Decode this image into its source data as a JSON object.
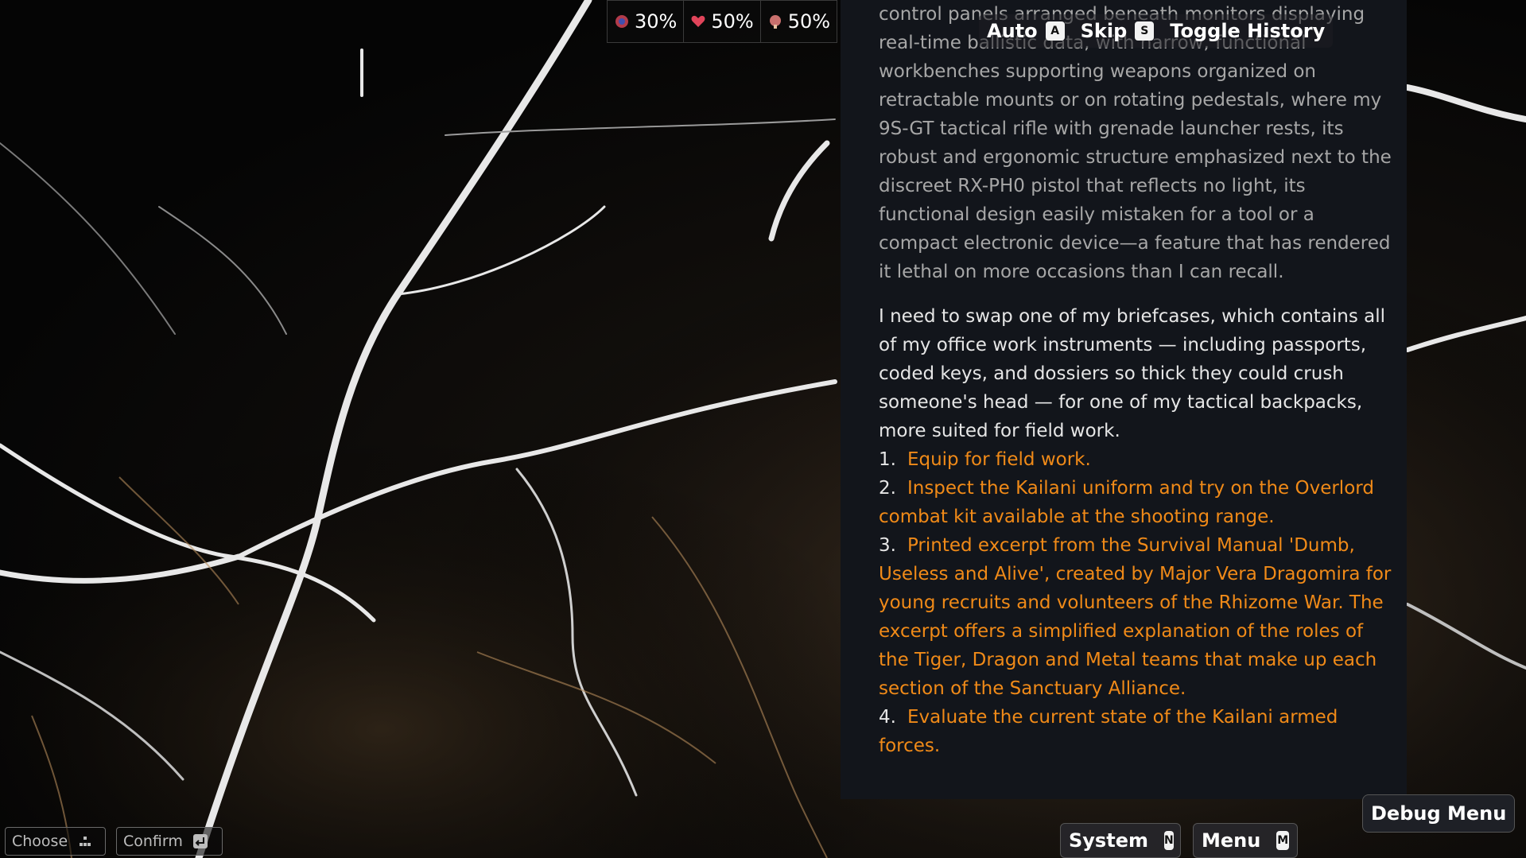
{
  "stats": [
    {
      "icon": "sanity-icon",
      "value": "30%",
      "color": "#b23b4a"
    },
    {
      "icon": "heart-icon",
      "value": "50%",
      "color": "#e0445a"
    },
    {
      "icon": "brain-icon",
      "value": "50%",
      "color": "#c9706d"
    }
  ],
  "controls": {
    "auto_label": "Auto",
    "auto_key": "A",
    "skip_label": "Skip",
    "skip_key": "S",
    "history_label": "Toggle History"
  },
  "narrative": {
    "faded_paragraph": "control panels arranged beneath monitors displaying real-time ballistic data, with narrow, functional workbenches supporting weapons organized on retractable mounts or on rotating pedestals, where my 9S-GT tactical rifle with grenade launcher rests, its robust and ergonomic structure emphasized next to the discreet RX-PH0 pistol that reflects no light, its functional design easily mistaken for a tool or a compact electronic device—a feature that has rendered it lethal on more occasions than I can recall.",
    "main_paragraph": "I need to swap one of my briefcases, which contains all of my office work instruments — including passports, coded keys, and dossiers so thick they could crush someone's head — for one of my tactical backpacks, more suited for field work."
  },
  "options": [
    {
      "num": "1.",
      "text": "Equip for field work."
    },
    {
      "num": "2.",
      "text": "Inspect the Kailani uniform and try on the Overlord combat kit available at the shooting range."
    },
    {
      "num": "3.",
      "text": "Printed excerpt from the Survival Manual 'Dumb, Useless and Alive', created by Major Vera Dragomira for young recruits and volunteers of the Rhizome War. The excerpt offers a simplified explanation of the roles of the Tiger, Dragon and Metal teams that make up each section of the Sanctuary Alliance."
    },
    {
      "num": "4.",
      "text": "Evaluate the current state of the Kailani armed forces."
    }
  ],
  "bottom_left": {
    "choose_label": "Choose",
    "confirm_label": "Confirm"
  },
  "bottom": {
    "system_label": "System",
    "system_key": "N",
    "menu_label": "Menu",
    "menu_key": "M",
    "debug_label": "Debug Menu"
  },
  "colors": {
    "option_text": "#f08a18",
    "panel_bg": "#12151b"
  }
}
